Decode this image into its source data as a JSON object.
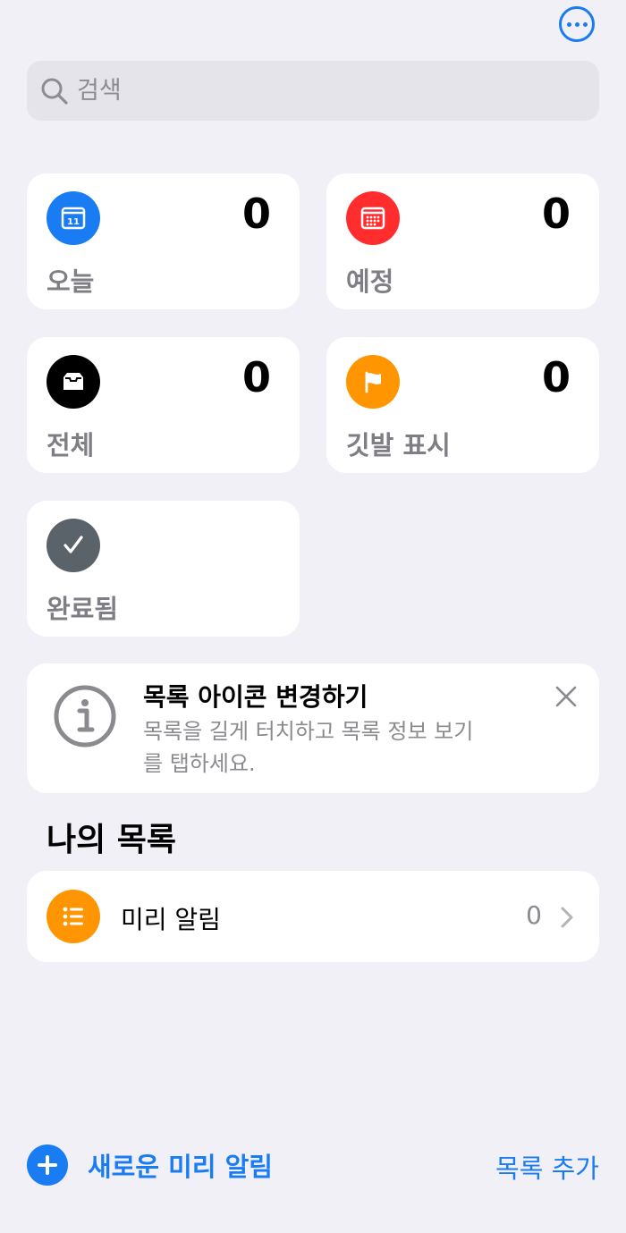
{
  "header": {
    "more_icon": "ellipsis-circle-icon"
  },
  "search": {
    "placeholder": "검색",
    "icon": "search-icon"
  },
  "smart_lists": [
    {
      "id": "today",
      "label": "오늘",
      "count": "0",
      "icon": "calendar-today-icon",
      "color": "#1a7cf2",
      "icon_text": "11"
    },
    {
      "id": "scheduled",
      "label": "예정",
      "count": "0",
      "icon": "calendar-grid-icon",
      "color": "#ff2d2d"
    },
    {
      "id": "all",
      "label": "전체",
      "count": "0",
      "icon": "tray-icon",
      "color": "#000000"
    },
    {
      "id": "flagged",
      "label": "깃발 표시",
      "count": "0",
      "icon": "flag-icon",
      "color": "#ff9500"
    },
    {
      "id": "completed",
      "label": "완료됨",
      "icon": "checkmark-icon",
      "color": "#5b636a"
    }
  ],
  "tip": {
    "title": "목록 아이콘 변경하기",
    "body": "목록을 길게 터치하고 목록 정보 보기를 탭하세요.",
    "icon": "info-icon",
    "close_icon": "close-icon"
  },
  "my_lists": {
    "title": "나의 목록",
    "items": [
      {
        "name": "미리 알림",
        "count": "0",
        "icon": "list-bullet-icon",
        "color": "#ff9500"
      }
    ]
  },
  "toolbar": {
    "new_reminder_label": "새로운 미리 알림",
    "add_list_label": "목록 추가",
    "accent": "#1a7cf2"
  }
}
